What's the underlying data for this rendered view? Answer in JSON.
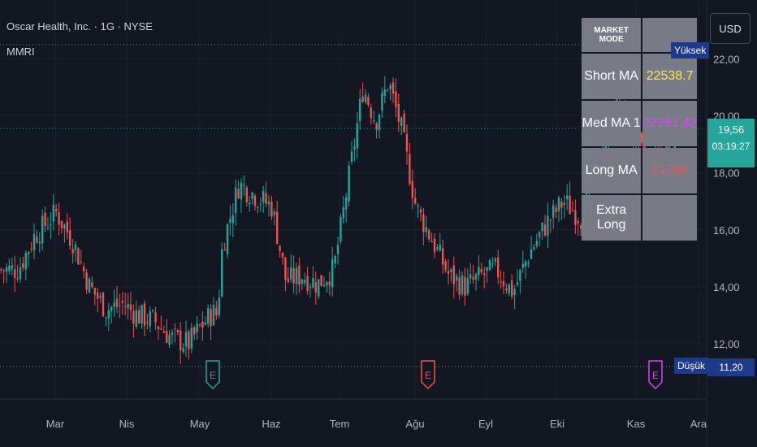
{
  "header": {
    "title": "Oscar Health, Inc. · 1G · NYSE",
    "indicator": "MMRI"
  },
  "toolbar": {
    "currency": "USD"
  },
  "table": {
    "title": "MARKET MODE",
    "header_value": "",
    "rows": [
      {
        "label": "Short MA",
        "value": "22538.7",
        "color": "#ffeb3b"
      },
      {
        "label": "Med MA 1",
        "value": "22291.42",
        "color": "#e040fb"
      },
      {
        "label": "Long MA",
        "value": "21706",
        "color": "#ef5350"
      },
      {
        "label": "Extra Long",
        "value": "",
        "color": "#ffffff"
      }
    ]
  },
  "labels": {
    "high": "Yüksek",
    "low": "Düşük",
    "low_value": "11,20",
    "current_price": "19,56",
    "countdown": "03:19:27"
  },
  "colors": {
    "background": "#131722",
    "up": "#26a69a",
    "down": "#ef5350",
    "grid": "#1e222d",
    "earnings_past_up": "#26a69a",
    "earnings_past_down": "#ef5350",
    "earnings_future": "#e040fb"
  },
  "chart_data": {
    "type": "candlestick",
    "x_ticks": [
      "Mar",
      "Nis",
      "May",
      "Haz",
      "Tem",
      "Ağu",
      "Eyl",
      "Eki",
      "Kas",
      "Ara"
    ],
    "y_ticks": [
      "12,00",
      "14,00",
      "16,00",
      "18,00",
      "20,00",
      "22,00"
    ],
    "ylim": [
      11,
      22.5
    ],
    "high": 22.5,
    "low": 11.2,
    "last": 19.56,
    "earnings": [
      {
        "month": "May",
        "label": "E",
        "kind": "past-up"
      },
      {
        "month": "Ağu",
        "label": "E",
        "kind": "past-down"
      },
      {
        "month": "Kas",
        "label": "E",
        "kind": "future"
      }
    ],
    "close_path": [
      [
        "Feb-15",
        14.6
      ],
      [
        "Feb-22",
        15.8
      ],
      [
        "Mar-01",
        16.6
      ],
      [
        "Mar-08",
        15.6
      ],
      [
        "Mar-15",
        14.0
      ],
      [
        "Mar-22",
        13.2
      ],
      [
        "Mar-29",
        13.4
      ],
      [
        "Apr-05",
        13.0
      ],
      [
        "Apr-12",
        12.8
      ],
      [
        "Apr-19",
        12.2
      ],
      [
        "Apr-26",
        12.0
      ],
      [
        "May-01",
        12.6
      ],
      [
        "May-06",
        13.1
      ],
      [
        "May-08",
        13.0
      ],
      [
        "May-10",
        15.4
      ],
      [
        "May-17",
        17.6
      ],
      [
        "May-24",
        17.2
      ],
      [
        "May-31",
        16.8
      ],
      [
        "Jun-07",
        14.2
      ],
      [
        "Jun-14",
        14.4
      ],
      [
        "Jun-21",
        14.1
      ],
      [
        "Jun-28",
        14.6
      ],
      [
        "Jul-01",
        16.0
      ],
      [
        "Jul-05",
        18.2
      ],
      [
        "Jul-10",
        21.0
      ],
      [
        "Jul-15",
        19.8
      ],
      [
        "Jul-20",
        21.2
      ],
      [
        "Jul-25",
        19.6
      ],
      [
        "Aug-01",
        16.8
      ],
      [
        "Aug-08",
        15.6
      ],
      [
        "Aug-15",
        14.4
      ],
      [
        "Aug-22",
        14.0
      ],
      [
        "Aug-29",
        14.4
      ],
      [
        "Sep-05",
        14.6
      ],
      [
        "Sep-12",
        13.8
      ],
      [
        "Sep-19",
        15.2
      ],
      [
        "Sep-26",
        16.2
      ],
      [
        "Oct-03",
        17.0
      ],
      [
        "Oct-10",
        16.4
      ],
      [
        "Oct-17",
        18.6
      ],
      [
        "Oct-24",
        20.4
      ],
      [
        "Oct-31",
        19.0
      ],
      [
        "Nov-07",
        18.2
      ],
      [
        "Nov-14",
        18.8
      ],
      [
        "Nov-21",
        19.56
      ]
    ]
  }
}
